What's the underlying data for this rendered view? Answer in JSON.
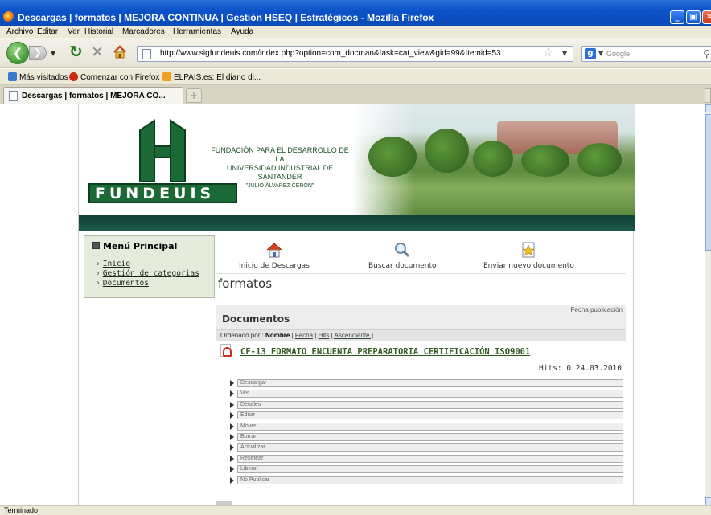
{
  "window": {
    "title": "Descargas | formatos | MEJORA CONTINUA | Gestión HSEQ | Estratégicos - Mozilla Firefox"
  },
  "menubar": [
    "Archivo",
    "Editar",
    "Ver",
    "Historial",
    "Marcadores",
    "Herramientas",
    "Ayuda"
  ],
  "navbar": {
    "url": "http://www.sigfundeuis.com/index.php?option=com_docman&task=cat_view&gid=99&Itemid=53",
    "search_placeholder": "Google"
  },
  "bookmarks": [
    "Más visitados",
    "Comenzar con Firefox",
    "ELPAIS.es: El diario di..."
  ],
  "tab": {
    "label": "Descargas | formatos | MEJORA CO..."
  },
  "header": {
    "logo_text": "FUNDEUIS",
    "foundation_line1": "FUNDACIÓN PARA EL DESARROLLO DE LA",
    "foundation_line2": "UNIVERSIDAD INDUSTRIAL DE SANTANDER",
    "foundation_line3": "\"JULIO ÁLVAREZ CERÓN\""
  },
  "sidebar": {
    "title": "Menú Principal",
    "items": [
      "Inicio",
      "Gestión de categorias",
      "Documentos"
    ]
  },
  "quicklinks": [
    {
      "label": "Inicio de Descargas",
      "icon": "home-icon"
    },
    {
      "label": "Buscar documento",
      "icon": "search-icon"
    },
    {
      "label": "Enviar nuevo documento",
      "icon": "upload-document-icon"
    }
  ],
  "main": {
    "page_title": "formatos",
    "panel_title": "Documentos",
    "date_header": "Fecha publicación",
    "sort_prefix": "Ordenado por :",
    "sort_current": "Nombre",
    "sort_fecha": "Fecha",
    "sort_hits": "Hits",
    "sort_order": "[ Ascendiente ]",
    "document": {
      "title": "CF-13 FORMATO ENCUENTA PREPARATORIA CERTIFICACIÓN ISO9001",
      "hits": "Hits: 0 24.03.2010"
    },
    "actions": [
      "Descargar",
      "Ver",
      "Detalles",
      "Editar",
      "Mover",
      "Borrar",
      "Actualizar",
      "Resetear",
      "Liberar",
      "No Publicar"
    ]
  },
  "status": "Terminado",
  "colors": {
    "titlebar": "#0c53c8",
    "brand_green": "#1b6a35",
    "link_green": "#2f5a1e"
  }
}
